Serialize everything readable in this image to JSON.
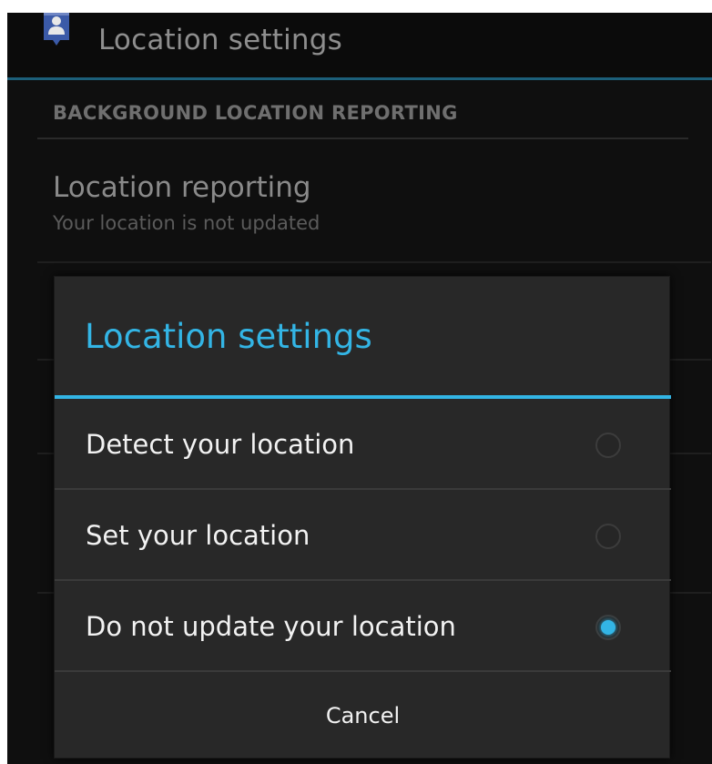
{
  "action_bar": {
    "title": "Location settings",
    "icon": "location-person-icon"
  },
  "background_list": {
    "section_header": "BACKGROUND LOCATION REPORTING",
    "pref_title": "Location reporting",
    "pref_summary": "Your location is not updated"
  },
  "dialog": {
    "title": "Location settings",
    "options": [
      {
        "label": "Detect your location",
        "selected": false
      },
      {
        "label": "Set your location",
        "selected": false
      },
      {
        "label": "Do not update your location",
        "selected": true
      }
    ],
    "cancel_label": "Cancel"
  },
  "colors": {
    "accent": "#33b5e5",
    "dialog_bg": "#282828",
    "screen_bg": "#0f0f0f"
  }
}
